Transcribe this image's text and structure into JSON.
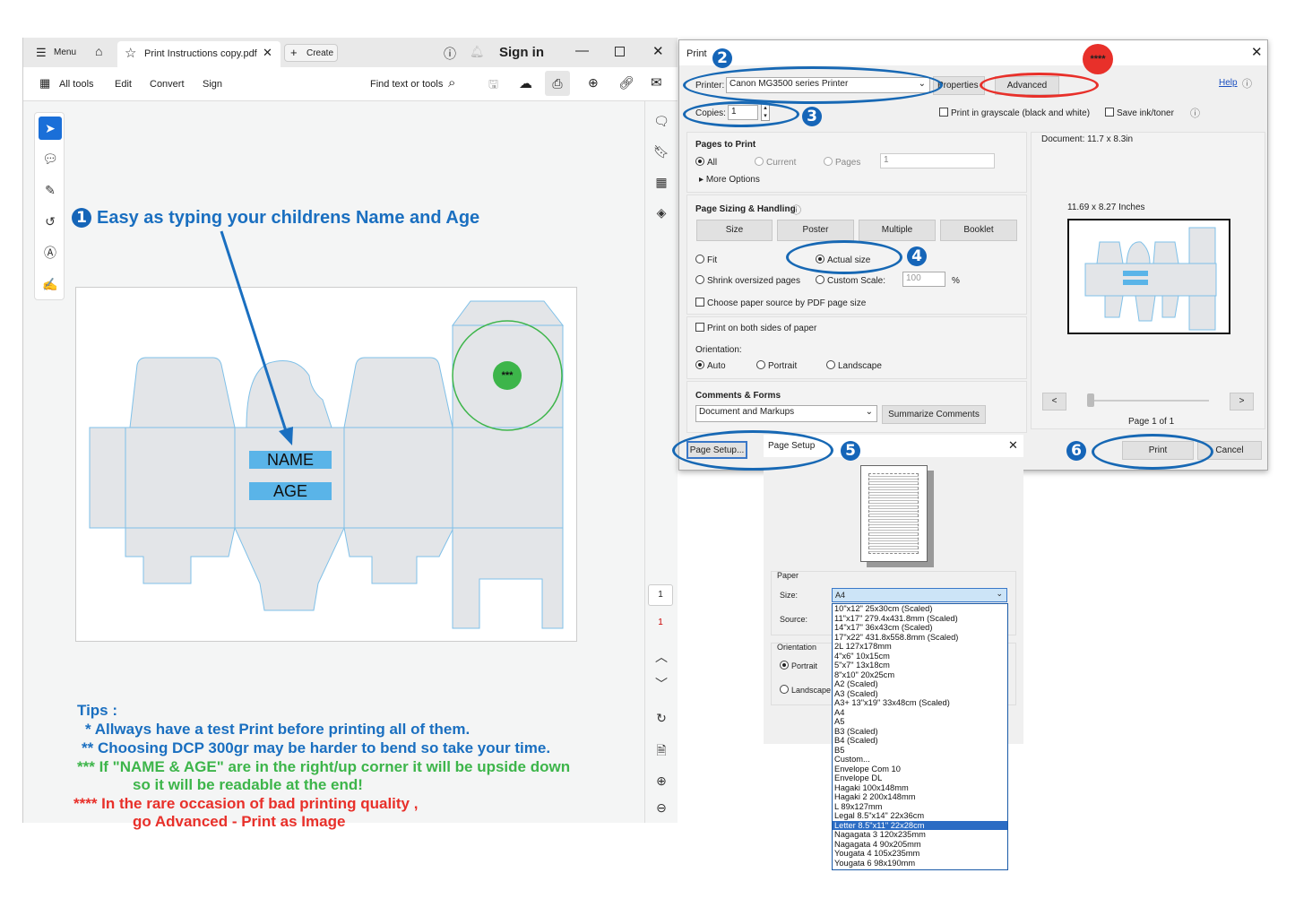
{
  "app": {
    "menu_label": "Menu",
    "tab_title": "Print Instructions copy.pdf",
    "create_label": "Create",
    "sign_in": "Sign in",
    "toolbar": {
      "all_tools": "All tools",
      "edit": "Edit",
      "convert": "Convert",
      "sign": "Sign",
      "find": "Find text or tools"
    },
    "page_number": "1",
    "page_count": "1"
  },
  "document": {
    "step1": "Easy as typing your childrens Name and Age",
    "name_label": "NAME",
    "age_label": "AGE",
    "marker": "***",
    "tips_title": "Tips :",
    "tips": [
      {
        "text": "*  Allways have a test Print before printing all of them.",
        "color": "#1a6fc0"
      },
      {
        "text": "** Choosing DCP 300gr may be harder to bend so take your time.",
        "color": "#1a6fc0"
      },
      {
        "text": "*** If \"NAME & AGE\" are in the right/up corner it will be upside down",
        "color": "#3db54a"
      },
      {
        "text": "so it will be readable at the end!",
        "color": "#3db54a"
      },
      {
        "text": "**** In the rare occasion of bad printing quality ,",
        "color": "#e8302a"
      },
      {
        "text": "go Advanced - Print as Image",
        "color": "#e8302a"
      }
    ]
  },
  "print_dialog": {
    "title": "Print",
    "printer_label": "Printer:",
    "printer_value": "Canon MG3500 series Printer",
    "properties": "Properties",
    "advanced": "Advanced",
    "advanced_marker": "****",
    "help": "Help",
    "copies_label": "Copies:",
    "copies_value": "1",
    "grayscale": "Print in grayscale (black and white)",
    "save_ink": "Save ink/toner",
    "pages_to_print": "Pages to Print",
    "all": "All",
    "current": "Current",
    "pages": "Pages",
    "pages_value": "1",
    "more_options": "More Options",
    "sizing_title": "Page Sizing & Handling",
    "size": "Size",
    "poster": "Poster",
    "multiple": "Multiple",
    "booklet": "Booklet",
    "fit": "Fit",
    "actual_size": "Actual size",
    "shrink": "Shrink oversized pages",
    "custom_scale": "Custom Scale:",
    "scale_value": "100",
    "percent": "%",
    "paper_source": "Choose paper source by PDF page size",
    "both_sides": "Print on both sides of paper",
    "orientation": "Orientation:",
    "auto": "Auto",
    "portrait": "Portrait",
    "landscape": "Landscape",
    "comments_title": "Comments & Forms",
    "comments_value": "Document and Markups",
    "summarize": "Summarize Comments",
    "document_size": "Document: 11.7 x 8.3in",
    "preview_size": "11.69 x 8.27 Inches",
    "page_of": "Page 1 of 1",
    "prev": "<",
    "next": ">",
    "page_setup_btn": "Page Setup...",
    "print": "Print",
    "cancel": "Cancel"
  },
  "page_setup": {
    "title": "Page Setup",
    "paper": "Paper",
    "size_label": "Size:",
    "size_value": "A4",
    "source_label": "Source:",
    "orientation": "Orientation",
    "portrait": "Portrait",
    "landscape": "Landscape",
    "selected_option": "Letter 8.5\"x11\" 22x28cm",
    "options": [
      "10\"x12\" 25x30cm (Scaled)",
      "11\"x17\" 279.4x431.8mm (Scaled)",
      "14\"x17\" 36x43cm (Scaled)",
      "17\"x22\" 431.8x558.8mm (Scaled)",
      "2L 127x178mm",
      "4\"x6\" 10x15cm",
      "5\"x7\" 13x18cm",
      "8\"x10\" 20x25cm",
      "A2 (Scaled)",
      "A3 (Scaled)",
      "A3+ 13\"x19\" 33x48cm (Scaled)",
      "A4",
      "A5",
      "B3 (Scaled)",
      "B4 (Scaled)",
      "B5",
      "Custom...",
      "Envelope Com 10",
      "Envelope DL",
      "Hagaki 100x148mm",
      "Hagaki 2 200x148mm",
      "L 89x127mm",
      "Legal 8.5\"x14\" 22x36cm",
      "Letter 8.5\"x11\" 22x28cm",
      "Nagagata 3 120x235mm",
      "Nagagata 4 90x205mm",
      "Yougata 4 105x235mm",
      "Yougata 6 98x190mm"
    ]
  },
  "steps": [
    "1",
    "2",
    "3",
    "4",
    "5",
    "6"
  ],
  "colors": {
    "step_blue": "#1565b8",
    "red_marker": "#e8302a",
    "green_marker": "#3db54a",
    "dieline_fill": "#e3e5e8",
    "dieline_stroke": "#7fc0e8",
    "label_bg": "#5ab4e8"
  }
}
